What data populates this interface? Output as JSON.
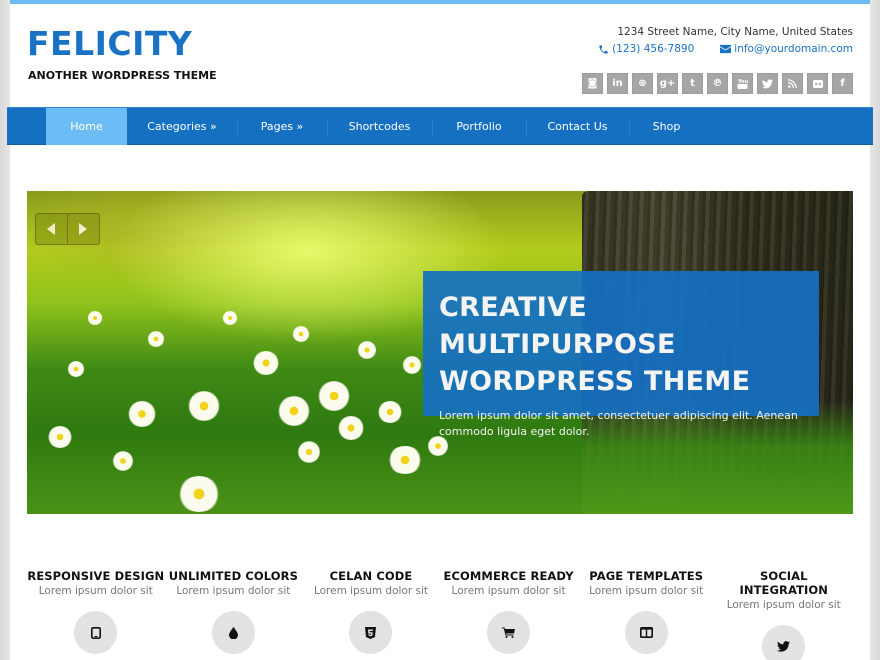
{
  "header": {
    "logo": "FELICITY",
    "tagline": "ANOTHER WORDPRESS THEME",
    "address": "1234 Street Name, City Name, United States",
    "phone": "(123) 456-7890",
    "email": "info@yourdomain.com",
    "social": [
      {
        "name": "instagram",
        "glyph": "◙"
      },
      {
        "name": "linkedin",
        "glyph": "in"
      },
      {
        "name": "dribbble",
        "glyph": "⊛"
      },
      {
        "name": "google-plus",
        "glyph": "g+"
      },
      {
        "name": "tumblr",
        "glyph": "t"
      },
      {
        "name": "pinterest",
        "glyph": "℗"
      },
      {
        "name": "youtube",
        "glyph": "▶"
      },
      {
        "name": "twitter",
        "glyph": "🐦"
      },
      {
        "name": "rss",
        "glyph": "⌇"
      },
      {
        "name": "flickr",
        "glyph": "••"
      },
      {
        "name": "facebook",
        "glyph": "f"
      }
    ]
  },
  "nav": {
    "active": "Home",
    "items": [
      "Home",
      "Categories »",
      "Pages »",
      "Shortcodes",
      "Portfolio",
      "Contact Us",
      "Shop"
    ]
  },
  "hero": {
    "title_line1": "CREATIVE MULTIPURPOSE",
    "title_line2": "WORDPRESS THEME",
    "text": "Lorem ipsum dolor sit amet, consectetuer adipiscing elit. Aenean commodo ligula eget dolor."
  },
  "features": [
    {
      "title": "RESPONSIVE DESIGN",
      "subtitle": "Lorem ipsum dolor sit",
      "icon": "tablet-icon"
    },
    {
      "title": "UNLIMITED COLORS",
      "subtitle": "Lorem ipsum dolor sit",
      "icon": "drop-icon"
    },
    {
      "title": "CELAN CODE",
      "subtitle": "Lorem ipsum dolor sit",
      "icon": "html5-icon"
    },
    {
      "title": "ECOMMERCE READY",
      "subtitle": "Lorem ipsum dolor sit",
      "icon": "cart-icon"
    },
    {
      "title": "PAGE TEMPLATES",
      "subtitle": "Lorem ipsum dolor sit",
      "icon": "columns-icon"
    },
    {
      "title": "SOCIAL INTEGRATION",
      "subtitle": "Lorem ipsum dolor sit",
      "icon": "twitter-icon"
    }
  ],
  "colors": {
    "brand": "#1a72c4",
    "nav_bg": "#1570c2",
    "nav_active": "#6cbdf6",
    "top_bar": "#6fbcf5",
    "social_bg": "#a6a6a6",
    "feature_circle": "#e2e2e2"
  }
}
